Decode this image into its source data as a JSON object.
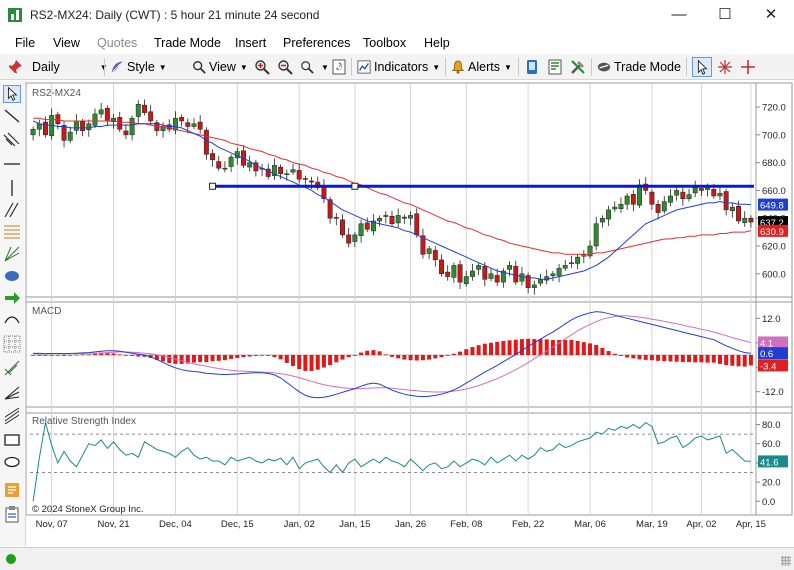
{
  "window": {
    "title": "RS2-MX24: Daily (CWT) : 5 hour 21 minute 24 second",
    "minimize": "—",
    "maximize": "☐",
    "close": "✕"
  },
  "menu": [
    "File",
    "View",
    "Quotes",
    "Trade Mode",
    "Insert",
    "Preferences",
    "Toolbox",
    "Help"
  ],
  "toolbar": {
    "interval": "Daily",
    "style": "Style",
    "view": "View",
    "indicators": "Indicators",
    "alerts": "Alerts",
    "trade_mode": "Trade Mode"
  },
  "chart": {
    "symbol_label": "RS2-MX24",
    "copyright": "© 2024 StoneX Group Inc.",
    "x_ticks": [
      "Nov, 07",
      "Nov, 21",
      "Dec, 04",
      "Dec, 15",
      "Jan, 02",
      "Jan, 15",
      "Jan, 26",
      "Feb, 08",
      "Feb, 22",
      "Mar, 06",
      "Mar, 19",
      "Apr, 02",
      "Apr, 15"
    ]
  },
  "chart_data": [
    {
      "type": "candlestick",
      "title": "RS2-MX24",
      "y_ticks": [
        720.0,
        700.0,
        680.0,
        660.0,
        640.0,
        620.0,
        600.0
      ],
      "y_tick_labels": [
        "720.0",
        "700.0",
        "680.0",
        "660.0",
        "640.0",
        "620.0",
        "600.0"
      ],
      "ylim": [
        584,
        733
      ],
      "horizontal_line": 663,
      "last_price_labels": [
        {
          "value": 649.8,
          "label": "649.8",
          "color": "#1f3fd0"
        },
        {
          "value": 637.2,
          "label": "637.2",
          "color": "#000000"
        },
        {
          "value": 630.9,
          "label": "630.9",
          "color": "#e02020"
        }
      ],
      "closes": [
        704,
        708,
        700,
        714,
        708,
        696,
        702,
        710,
        703,
        708,
        715,
        718,
        710,
        712,
        704,
        700,
        712,
        722,
        716,
        710,
        703,
        706,
        704,
        712,
        710,
        706,
        708,
        704,
        686,
        682,
        676,
        676,
        684,
        688,
        678,
        680,
        674,
        676,
        670,
        678,
        672,
        672,
        675,
        668,
        668,
        666,
        662,
        654,
        640,
        640,
        628,
        622,
        628,
        636,
        632,
        638,
        640,
        642,
        636,
        642,
        640,
        642,
        628,
        614,
        618,
        610,
        600,
        598,
        606,
        594,
        598,
        602,
        606,
        596,
        600,
        594,
        602,
        606,
        594,
        600,
        590,
        592,
        596,
        598,
        600,
        604,
        606,
        608,
        612,
        614,
        620,
        636,
        640,
        646,
        648,
        650,
        656,
        650,
        664,
        660,
        650,
        644,
        652,
        656,
        660,
        654,
        657,
        662,
        660,
        662,
        656,
        658,
        646,
        648,
        638,
        640,
        637.2
      ],
      "ma_blue": [
        710,
        708,
        707,
        707,
        706,
        706,
        705,
        705,
        705,
        705,
        706,
        706,
        707,
        707,
        707,
        707,
        707,
        708,
        708,
        708,
        708,
        707,
        706,
        706,
        705,
        703,
        701,
        699,
        696,
        694,
        691,
        689,
        687,
        685,
        683,
        681,
        678,
        676,
        674,
        672,
        670,
        668,
        666,
        664,
        662,
        660,
        657,
        655,
        652,
        649,
        646,
        644,
        642,
        640,
        638,
        637,
        636,
        635,
        634,
        633,
        631,
        630,
        628,
        626,
        624,
        622,
        620,
        618,
        616,
        614,
        612,
        610,
        608,
        606,
        604,
        602,
        601,
        600,
        599,
        598,
        597,
        597,
        596,
        596,
        597,
        598,
        599,
        600,
        601,
        602,
        604,
        606,
        609,
        612,
        616,
        620,
        624,
        628,
        632,
        636,
        638,
        640,
        642,
        644,
        646,
        647,
        648,
        649,
        650,
        651,
        651,
        652,
        651,
        651,
        650,
        650,
        649.8
      ],
      "ma_red": [
        712,
        712,
        711,
        711,
        711,
        710,
        710,
        710,
        710,
        710,
        710,
        710,
        710,
        710,
        709,
        709,
        709,
        708,
        708,
        707,
        706,
        706,
        705,
        704,
        703,
        702,
        701,
        700,
        699,
        698,
        697,
        696,
        694,
        693,
        692,
        690,
        689,
        688,
        686,
        685,
        683,
        682,
        680,
        679,
        678,
        676,
        675,
        673,
        672,
        670,
        669,
        667,
        665,
        664,
        662,
        660,
        658,
        657,
        655,
        653,
        651,
        650,
        648,
        646,
        644,
        642,
        640,
        638,
        637,
        635,
        633,
        632,
        630,
        628,
        627,
        625,
        624,
        622,
        621,
        620,
        619,
        618,
        617,
        616,
        615,
        615,
        614,
        614,
        614,
        614,
        614,
        615,
        615,
        616,
        617,
        618,
        619,
        620,
        621,
        622,
        623,
        624,
        625,
        625,
        626,
        626,
        627,
        627,
        628,
        628,
        628,
        629,
        629,
        630,
        630,
        630,
        630.9
      ]
    },
    {
      "type": "line",
      "title": "MACD",
      "y_ticks": [
        12.0,
        4.0,
        -4.0,
        -12.0
      ],
      "y_tick_labels": [
        "12.0",
        "4.0",
        "-4.0",
        "-12.0"
      ],
      "ylim": [
        -17,
        17
      ],
      "last_value_labels": [
        {
          "value": 4.1,
          "label": "4.1",
          "color": "#d070c0"
        },
        {
          "value": 0.6,
          "label": "0.6",
          "color": "#1f3fd0"
        },
        {
          "value": -3.4,
          "label": "-3.4",
          "color": "#e02020"
        }
      ],
      "macd": [
        0.5,
        0.4,
        0.4,
        0.5,
        0.5,
        0.4,
        0.5,
        0.6,
        0.7,
        0.8,
        1.0,
        1.2,
        1.4,
        1.4,
        1.2,
        0.9,
        0.6,
        0.3,
        0.0,
        -0.6,
        -1.5,
        -2.4,
        -3.4,
        -4.2,
        -4.8,
        -5.2,
        -5.4,
        -5.6,
        -6.0,
        -6.1,
        -6.3,
        -6.4,
        -6.3,
        -6.2,
        -6.0,
        -5.9,
        -5.8,
        -5.8,
        -6.0,
        -6.5,
        -7.5,
        -9.0,
        -10.5,
        -12.0,
        -13.2,
        -13.8,
        -14.0,
        -13.8,
        -13.4,
        -12.8,
        -12.2,
        -11.6,
        -11.0,
        -10.2,
        -9.5,
        -9.2,
        -9.5,
        -10.5,
        -11.5,
        -12.2,
        -12.8,
        -13.2,
        -13.5,
        -13.6,
        -13.5,
        -13.2,
        -12.8,
        -12.2,
        -11.4,
        -10.4,
        -9.2,
        -8.0,
        -6.8,
        -5.6,
        -4.5,
        -3.4,
        -2.2,
        -1.0,
        0.2,
        1.5,
        2.8,
        4.0,
        5.2,
        6.4,
        7.5,
        8.8,
        10.2,
        11.5,
        12.5,
        13.2,
        13.8,
        14.2,
        14.0,
        13.5,
        13.0,
        12.5,
        12.0,
        11.5,
        11.0,
        10.5,
        10.0,
        9.5,
        9.0,
        8.5,
        8.0,
        7.5,
        7.0,
        6.5,
        6.0,
        5.5,
        5.0,
        4.0,
        3.0,
        2.2,
        1.4,
        0.8,
        0.6
      ],
      "signal": [
        0.6,
        0.6,
        0.5,
        0.5,
        0.5,
        0.5,
        0.5,
        0.5,
        0.5,
        0.6,
        0.6,
        0.7,
        0.8,
        0.9,
        1.0,
        1.0,
        0.9,
        0.8,
        0.6,
        0.4,
        0.1,
        -0.3,
        -0.8,
        -1.3,
        -1.9,
        -2.4,
        -2.9,
        -3.3,
        -3.7,
        -4.1,
        -4.4,
        -4.7,
        -5.0,
        -5.2,
        -5.3,
        -5.4,
        -5.5,
        -5.6,
        -5.7,
        -5.8,
        -6.1,
        -6.4,
        -6.9,
        -7.4,
        -8.0,
        -8.6,
        -9.2,
        -9.7,
        -10.1,
        -10.4,
        -10.7,
        -10.9,
        -11.0,
        -11.0,
        -10.9,
        -10.8,
        -10.7,
        -10.7,
        -10.9,
        -11.1,
        -11.3,
        -11.5,
        -11.7,
        -11.9,
        -12.0,
        -12.1,
        -12.1,
        -12.0,
        -11.8,
        -11.5,
        -11.1,
        -10.6,
        -10.0,
        -9.3,
        -8.5,
        -7.7,
        -6.8,
        -5.8,
        -4.8,
        -3.7,
        -2.5,
        -1.2,
        0.0,
        1.3,
        2.6,
        3.9,
        5.3,
        6.6,
        7.9,
        9.0,
        10.0,
        10.9,
        11.7,
        12.2,
        12.6,
        12.8,
        12.8,
        12.6,
        12.4,
        12.1,
        11.7,
        11.4,
        11.0,
        10.6,
        10.2,
        9.8,
        9.3,
        8.9,
        8.4,
        8.0,
        7.5,
        6.9,
        6.3,
        5.7,
        5.1,
        4.6,
        4.1
      ],
      "histogram": [
        -0.1,
        -0.2,
        -0.1,
        0.0,
        0.0,
        -0.1,
        0.0,
        0.1,
        0.2,
        0.2,
        0.4,
        0.5,
        0.6,
        0.5,
        0.2,
        -0.1,
        -0.3,
        -0.5,
        -0.6,
        -1.0,
        -1.6,
        -2.1,
        -2.6,
        -2.9,
        -2.9,
        -2.8,
        -2.5,
        -2.3,
        -2.3,
        -2.0,
        -1.9,
        -1.7,
        -1.3,
        -1.0,
        -0.7,
        -0.5,
        -0.3,
        -0.2,
        -0.3,
        -0.7,
        -1.4,
        -2.6,
        -3.6,
        -4.6,
        -5.2,
        -5.2,
        -4.8,
        -4.1,
        -3.3,
        -2.4,
        -1.5,
        -0.7,
        0.0,
        0.8,
        1.4,
        1.6,
        1.2,
        0.2,
        -0.6,
        -1.1,
        -1.5,
        -1.7,
        -1.8,
        -1.7,
        -1.5,
        -1.1,
        -0.7,
        -0.2,
        0.4,
        1.1,
        1.9,
        2.6,
        3.2,
        3.7,
        4.0,
        4.3,
        4.6,
        4.8,
        5.0,
        5.2,
        5.3,
        5.2,
        5.2,
        5.1,
        4.9,
        4.9,
        4.9,
        4.9,
        4.6,
        4.2,
        3.8,
        3.3,
        2.3,
        1.3,
        0.4,
        -0.3,
        -0.8,
        -1.1,
        -1.4,
        -1.6,
        -1.7,
        -1.9,
        -2.0,
        -2.1,
        -2.2,
        -2.3,
        -2.3,
        -2.4,
        -2.4,
        -2.5,
        -2.5,
        -2.9,
        -3.3,
        -3.5,
        -3.7,
        -3.8,
        -3.4
      ]
    },
    {
      "type": "line",
      "title": "Relative Strength Index",
      "y_ticks": [
        80.0,
        60.0,
        40.0,
        20.0,
        0.0
      ],
      "y_tick_labels": [
        "80.0",
        "60.0",
        "40.0",
        "20.0",
        "0.0"
      ],
      "ylim": [
        -8,
        92
      ],
      "dashed_levels": [
        70,
        30
      ],
      "last_value_label": {
        "value": 41.6,
        "label": "41.6",
        "color": "#1a8a8a"
      },
      "values": [
        0,
        45,
        82,
        58,
        40,
        52,
        42,
        36,
        48,
        60,
        58,
        64,
        55,
        62,
        54,
        48,
        50,
        46,
        62,
        58,
        54,
        52,
        50,
        46,
        52,
        56,
        48,
        44,
        46,
        42,
        42,
        38,
        46,
        42,
        44,
        46,
        42,
        40,
        44,
        42,
        45,
        38,
        46,
        34,
        40,
        42,
        44,
        36,
        30,
        38,
        30,
        40,
        44,
        36,
        40,
        44,
        40,
        46,
        42,
        40,
        36,
        44,
        38,
        32,
        38,
        40,
        34,
        36,
        42,
        36,
        40,
        44,
        42,
        38,
        46,
        40,
        44,
        48,
        42,
        48,
        44,
        48,
        56,
        52,
        54,
        60,
        56,
        58,
        62,
        64,
        66,
        72,
        70,
        76,
        74,
        78,
        76,
        80,
        76,
        82,
        78,
        60,
        62,
        66,
        68,
        56,
        60,
        66,
        68,
        64,
        66,
        68,
        50,
        54,
        48,
        42,
        41.6
      ]
    }
  ]
}
